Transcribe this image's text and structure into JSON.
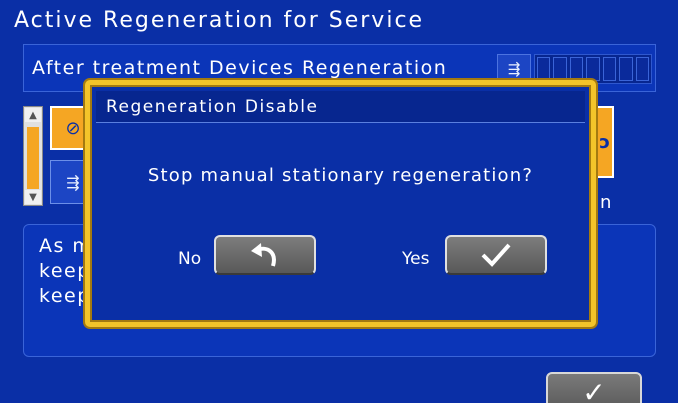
{
  "screen": {
    "title": "Active Regeneration for Service"
  },
  "panel": {
    "subtitle": "After treatment Devices Regeneration",
    "level_icon": "regeneration-icon",
    "level_segments": 7
  },
  "side": {
    "mode_icon_1": "regen-disabled-icon",
    "mode_icon_2": "regen-hand-icon",
    "right_label": "in"
  },
  "info": {
    "lines": [
      "As m",
      "keep",
      "keep"
    ]
  },
  "dialog": {
    "title": "Regeneration  Disable",
    "message": "Stop manual stationary regeneration?",
    "no_label": "No",
    "yes_label": "Yes",
    "no_icon": "undo-arrow-icon",
    "yes_icon": "check-icon"
  },
  "colors": {
    "background": "#0a2fa6",
    "dialog_border": "#f3c42a",
    "accent": "#f5a623"
  }
}
